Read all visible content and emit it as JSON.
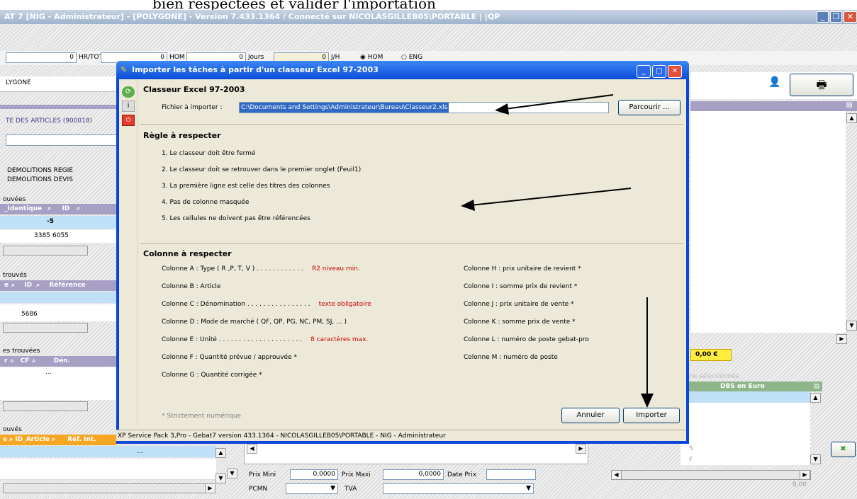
{
  "doc_top_text": "bien respectées et valider l'importation",
  "window": {
    "title": "AT 7 [NIG - Administrateur] - [POLYGONE]  - Version 7.433.1364 / Connecté sur NICOLASGILLEB05\\PORTABLE | |QP"
  },
  "toolbar": {
    "field1_value": "0",
    "field1_unit": "HR/TOT",
    "field2_value": "0",
    "field2_unit": "HOM",
    "field3_value": "0",
    "field3_unit": "Jours",
    "field4_value": "0",
    "field4_unit": "J/H",
    "radio_hom": "HOM",
    "radio_eng": "ENG"
  },
  "left": {
    "polygone": "LYGONE",
    "articles_header": "TE DES ARTICLES  (900018)",
    "demolitions_regie": "DEMOLITIONS REGIE",
    "demolitions_devis": "DEMOLITIONS DEVIS",
    "t1_title": "ouvées",
    "t1_col1": "_Identique",
    "t1_col2": "ID",
    "t1_row1_val": "-5",
    "t1_row2_a": "3385",
    "t1_row2_b": "6055",
    "t2_title": "trouvés",
    "t2_col1": "e",
    "t2_col2": "ID",
    "t2_col3": "Référence",
    "t2_row_val": "5686",
    "t3_title": "es trouvées",
    "t3_col1": "r",
    "t3_col2": "CF",
    "t3_col3": "Dén.",
    "t3_row_val": "...",
    "t4_title": "ouvés",
    "t4_col1": "e",
    "t4_col2": "ID_Article",
    "t4_col3": "Réf. Int.",
    "t4_row_val": "..."
  },
  "right": {
    "total_value": "0,00 €",
    "selection_label": "ne sélectionnée",
    "dbs_header": "DBS en Euro",
    "row_s": "S",
    "row_f": "F",
    "bottom_value": "0,00"
  },
  "bottom": {
    "prix_mini_label": "Prix Mini",
    "prix_mini_value": "0,0000",
    "prix_maxi_label": "Prix Maxi",
    "prix_maxi_value": "0,0000",
    "date_prix_label": "Date Prix",
    "date_prix_value": "",
    "pcmn_label": "PCMN",
    "tva_label": "TVA"
  },
  "dialog": {
    "title": "Importer les tâches à partir d'un classeur Excel 97-2003",
    "section_classeur": "Classeur Excel 97-2003",
    "file_label": "Fichier à importer :",
    "file_value": "C:\\Documents and Settings\\Administrateur\\Bureau\\Classeur2.xls",
    "browse_button": "Parcourir ...",
    "section_regle": "Règle à respecter",
    "rules": [
      "1. Le classeur doit être fermé",
      "2. Le classeur doit se retrouver dans le premier onglet (Feuil1)",
      "3. La première ligne est celle des titres des colonnes",
      "4. Pas de colonne masquée",
      "5. Les cellules ne doivent pas être référencées"
    ],
    "section_colonne": "Colonne à respecter",
    "columns_left": [
      {
        "text": "Colonne A : Type  ( R ,P, T, V ) . . . . . . . . . . . .",
        "note": "R2 niveau min."
      },
      {
        "text": "Colonne B : Article",
        "note": ""
      },
      {
        "text": "Colonne C : Dénomination . . . . . . . . . . . . . . . .",
        "note": "texte obligatoire"
      },
      {
        "text": "Colonne D : Mode de marché ( QF, QP, PG, NC, PM, SJ, ... )",
        "note": ""
      },
      {
        "text": "Colonne E : Unité . . . . . . . . . . . . . . . . . . . . .",
        "note": "8 caractères max."
      },
      {
        "text": "Colonne F : Quantité prévue / approuvée *",
        "note": ""
      },
      {
        "text": "Colonne G : Quantité corrigée *",
        "note": ""
      }
    ],
    "columns_right": [
      "Colonne H : prix unitaire de revient *",
      "Colonne I : somme prix de revient *",
      "Colonne J : prix unitaire de vente *",
      "Colonne K : somme prix de vente *",
      "Colonne L : numéro de poste gebat-pro",
      "Colonne M : numéro de poste"
    ],
    "footnote": "* Strictement numérique",
    "cancel_button": "Annuler",
    "import_button": "Importer",
    "status_bar": "XP Service Pack 3,Pro - Gebat7 version 433.1364 - NICOLASGILLEB05\\PORTABLE - NIG - Administrateur"
  },
  "colors": {
    "xp_blue": "#0845d8",
    "dialog_bg": "#ece9d8",
    "grid_header": "#a8a0c4",
    "orange_header": "#f5a623",
    "red_note": "#cc0000",
    "row_blue": "#bfe0f7"
  }
}
